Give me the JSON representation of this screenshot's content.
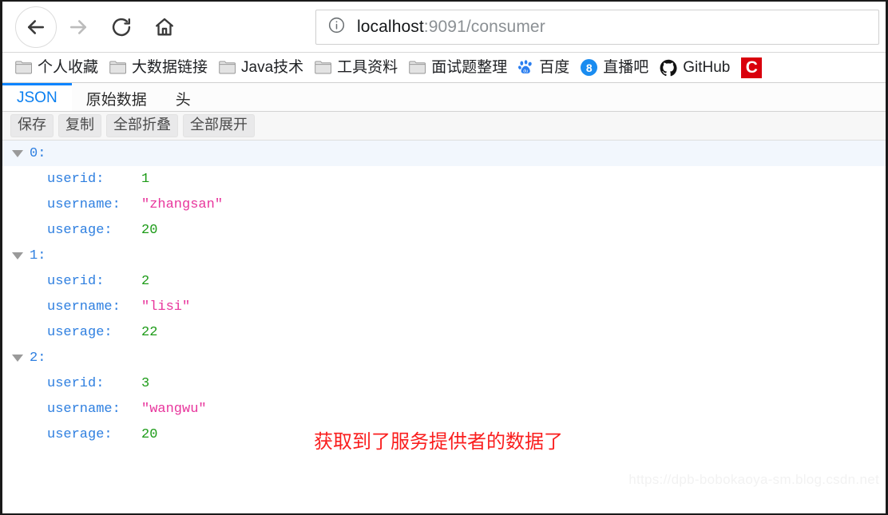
{
  "browser": {
    "nav": {
      "back_label": "Back",
      "forward_label": "Forward",
      "reload_label": "Reload",
      "home_label": "Home"
    },
    "url": {
      "host": "localhost",
      "path": ":9091/consumer",
      "security_icon": "info-icon"
    },
    "bookmarks": [
      {
        "label": "个人收藏",
        "icon": "folder-icon"
      },
      {
        "label": "大数据链接",
        "icon": "folder-icon"
      },
      {
        "label": "Java技术",
        "icon": "folder-icon"
      },
      {
        "label": "工具资料",
        "icon": "folder-icon"
      },
      {
        "label": "面试题整理",
        "icon": "folder-icon"
      },
      {
        "label": "百度",
        "icon": "baidu-icon"
      },
      {
        "label": "直播吧",
        "icon": "eight-circle-icon"
      },
      {
        "label": "GitHub",
        "icon": "github-icon"
      },
      {
        "label": "",
        "icon": "red-c-icon"
      }
    ]
  },
  "json_viewer": {
    "tabs": [
      {
        "label": "JSON",
        "active": true
      },
      {
        "label": "原始数据",
        "active": false
      },
      {
        "label": "头",
        "active": false
      }
    ],
    "toolbar": [
      {
        "label": "保存"
      },
      {
        "label": "复制"
      },
      {
        "label": "全部折叠"
      },
      {
        "label": "全部展开"
      }
    ],
    "entries": [
      {
        "index": "0:",
        "striped": true,
        "fields": [
          {
            "key": "userid:",
            "value": "1",
            "type": "number"
          },
          {
            "key": "username:",
            "value": "\"zhangsan\"",
            "type": "string"
          },
          {
            "key": "userage:",
            "value": "20",
            "type": "number"
          }
        ]
      },
      {
        "index": "1:",
        "striped": false,
        "fields": [
          {
            "key": "userid:",
            "value": "2",
            "type": "number"
          },
          {
            "key": "username:",
            "value": "\"lisi\"",
            "type": "string"
          },
          {
            "key": "userage:",
            "value": "22",
            "type": "number"
          }
        ]
      },
      {
        "index": "2:",
        "striped": false,
        "fields": [
          {
            "key": "userid:",
            "value": "3",
            "type": "number"
          },
          {
            "key": "username:",
            "value": "\"wangwu\"",
            "type": "string"
          },
          {
            "key": "userage:",
            "value": "20",
            "type": "number"
          }
        ]
      }
    ]
  },
  "annotation": {
    "text": "获取到了服务提供者的数据了",
    "color": "#fa1e1e"
  },
  "watermark": {
    "text": "https://dpb-bobokaoya-sm.blog.csdn.net"
  },
  "colors": {
    "accent_blue": "#0a84ff",
    "json_key": "#2e7fe0",
    "json_number": "#1d9b18",
    "json_string": "#e8359c",
    "annotation_red": "#fa1e1e",
    "bookmark_red": "#d9000d"
  }
}
